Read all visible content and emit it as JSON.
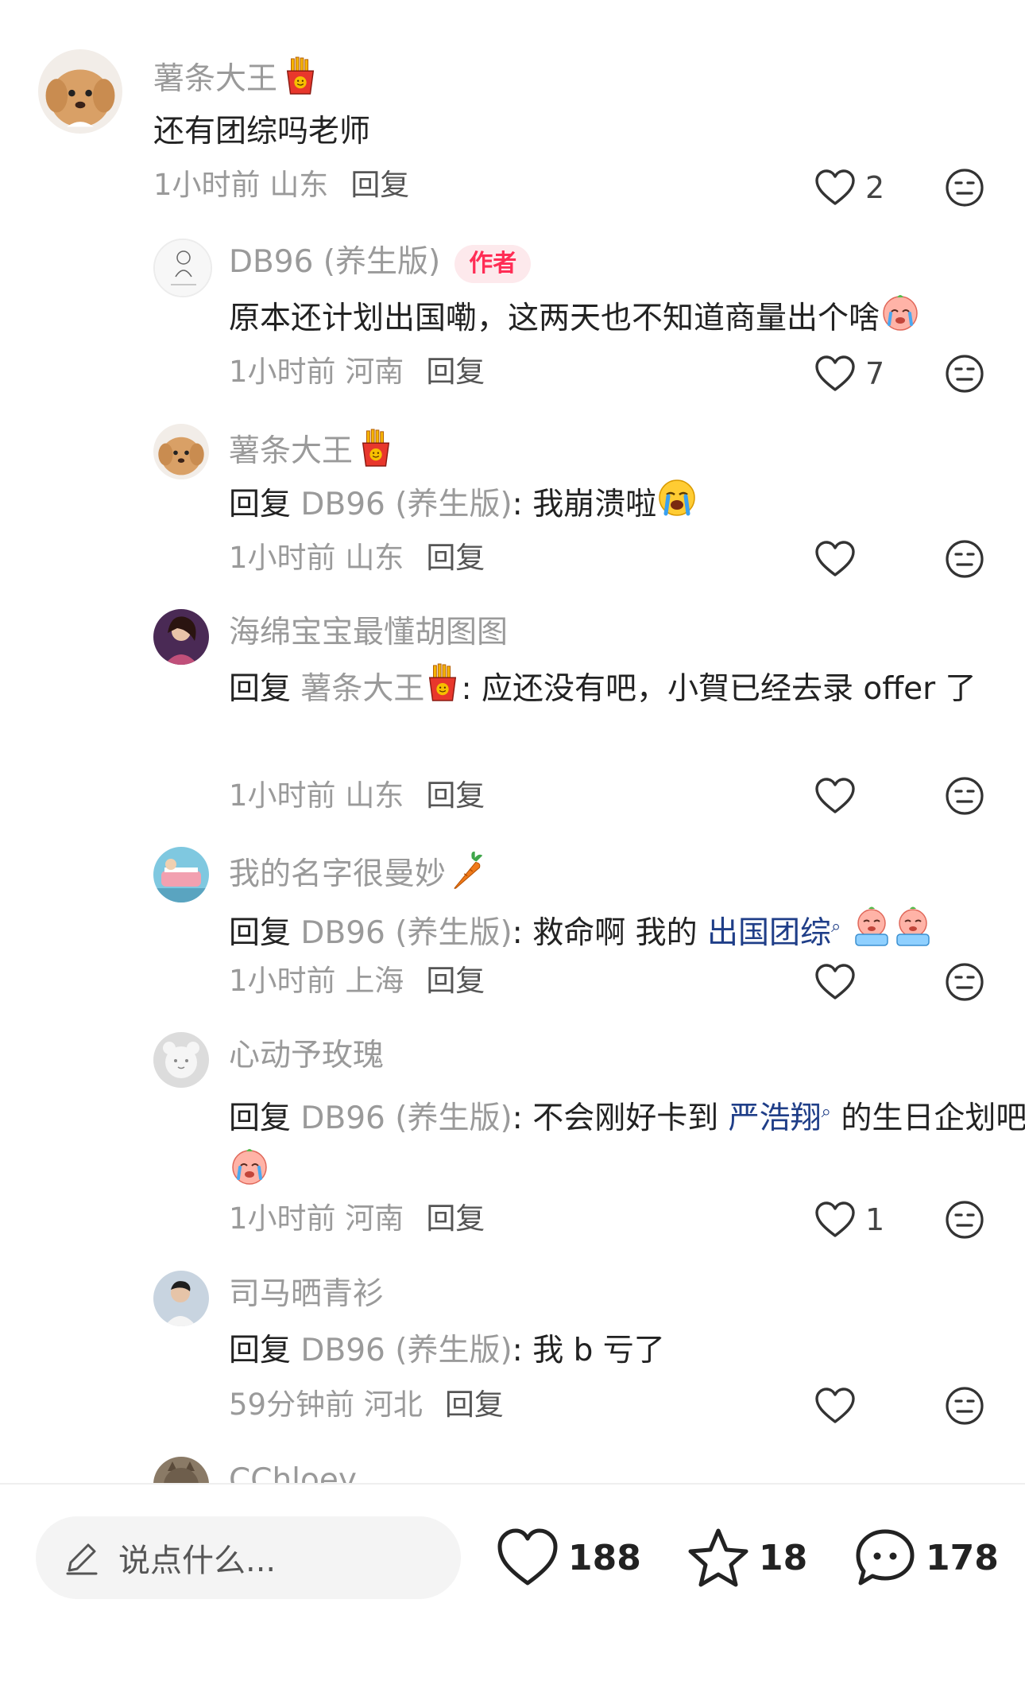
{
  "comments": [
    {
      "name": "薯条大王",
      "name_emoji": "fries",
      "text": "还有团综吗老师",
      "time": "1小时前",
      "location": "山东",
      "reply_label": "回复",
      "likes": "2"
    },
    {
      "name": "DB96 (养生版)",
      "author_badge": "作者",
      "text": "原本还计划出国嘞，这两天也不知道商量出个啥",
      "text_emoji": "crying-face",
      "time": "1小时前",
      "location": "河南",
      "reply_label": "回复",
      "likes": "7"
    },
    {
      "name": "薯条大王",
      "name_emoji": "fries",
      "reply_prefix": "回复",
      "reply_target": "DB96 (养生版)",
      "text": ": 我崩溃啦",
      "text_emoji": "loudly-crying",
      "time": "1小时前",
      "location": "山东",
      "reply_label": "回复",
      "likes": ""
    },
    {
      "name": "海绵宝宝最懂胡图图",
      "reply_prefix": "回复",
      "reply_target": "薯条大王",
      "target_emoji": "fries",
      "text": ": 应还没有吧，小賀已经去录 offer 了",
      "time": "1小时前",
      "location": "山东",
      "reply_label": "回复",
      "likes": ""
    },
    {
      "name": "我的名字很曼妙",
      "name_emoji": "carrot",
      "reply_prefix": "回复",
      "reply_target": "DB96 (养生版)",
      "text": ": 救命啊 我的 ",
      "link_tag": "出国团综",
      "text_emoji": "crying-bucket",
      "time": "1小时前",
      "location": "上海",
      "reply_label": "回复",
      "likes": ""
    },
    {
      "name": "心动予玫瑰",
      "reply_prefix": "回复",
      "reply_target": "DB96 (养生版)",
      "text": ": 不会刚好卡到 ",
      "link_tag": "严浩翔",
      "text_after": " 的生日企划吧",
      "text_emoji": "crying-face",
      "time": "1小时前",
      "location": "河南",
      "reply_label": "回复",
      "likes": "1"
    },
    {
      "name": "司马晒青衫",
      "reply_prefix": "回复",
      "reply_target": "DB96 (养生版)",
      "text": ": 我 b 亏了",
      "time": "59分钟前",
      "location": "河北",
      "reply_label": "回复",
      "likes": ""
    },
    {
      "name": "CChloey"
    }
  ],
  "bottom_bar": {
    "placeholder": "说点什么...",
    "likes": "188",
    "favorites": "18",
    "comments": "178"
  },
  "colors": {
    "accent_red": "#ff2d55",
    "link_blue": "#1f3e88",
    "muted_gray": "#9a9a9a"
  },
  "icons": [
    "heart-icon",
    "dislike-face-icon",
    "star-icon",
    "comment-bubble-icon",
    "pencil-icon",
    "fries-emoji",
    "carrot-emoji",
    "crying-emoji"
  ]
}
